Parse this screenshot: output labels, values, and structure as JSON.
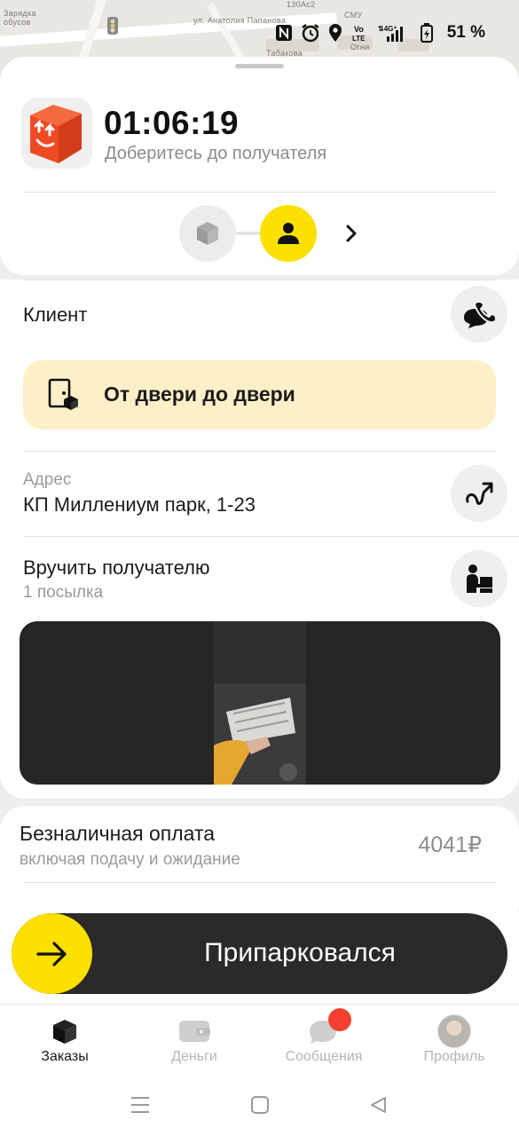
{
  "map": {
    "labels": [
      "Зарядка",
      "обусов",
      "ул. Анатолия Папанова",
      "130Ас2",
      "СМУ",
      "Табакова",
      "Огни"
    ]
  },
  "status_bar": {
    "battery": "51 %",
    "icons": [
      "nfc-icon",
      "alarm-icon",
      "location-icon",
      "volte-icon",
      "signal-4g-icon",
      "battery-icon"
    ]
  },
  "order": {
    "timer": "01:06:19",
    "timer_subtitle": "Доберитесь до получателя",
    "steps": [
      "parcel-step",
      "recipient-step"
    ]
  },
  "details": {
    "client_label": "Клиент",
    "door_to_door": "От двери до двери",
    "address_label": "Адрес",
    "address_value": "КП Миллениум парк, 1-23",
    "handover_title": "Вручить получателю",
    "handover_sub": "1 посылка"
  },
  "payment": {
    "title": "Безналичная оплата",
    "subtitle": "включая подачу и ожидание",
    "amount": "4041₽"
  },
  "action": {
    "slider_label": "Припарковался"
  },
  "tabs": [
    {
      "label": "Заказы",
      "icon": "orders-icon",
      "active": true
    },
    {
      "label": "Деньги",
      "icon": "wallet-icon",
      "active": false
    },
    {
      "label": "Сообщения",
      "icon": "chat-icon",
      "active": false
    },
    {
      "label": "Профиль",
      "icon": "avatar",
      "active": false
    }
  ],
  "colors": {
    "accent_yellow": "#fce000",
    "banner_bg": "#fdf0c8",
    "brand_orange": "#ef4a23",
    "notification_red": "#f5412d",
    "slider_dark": "#2b2a28"
  }
}
